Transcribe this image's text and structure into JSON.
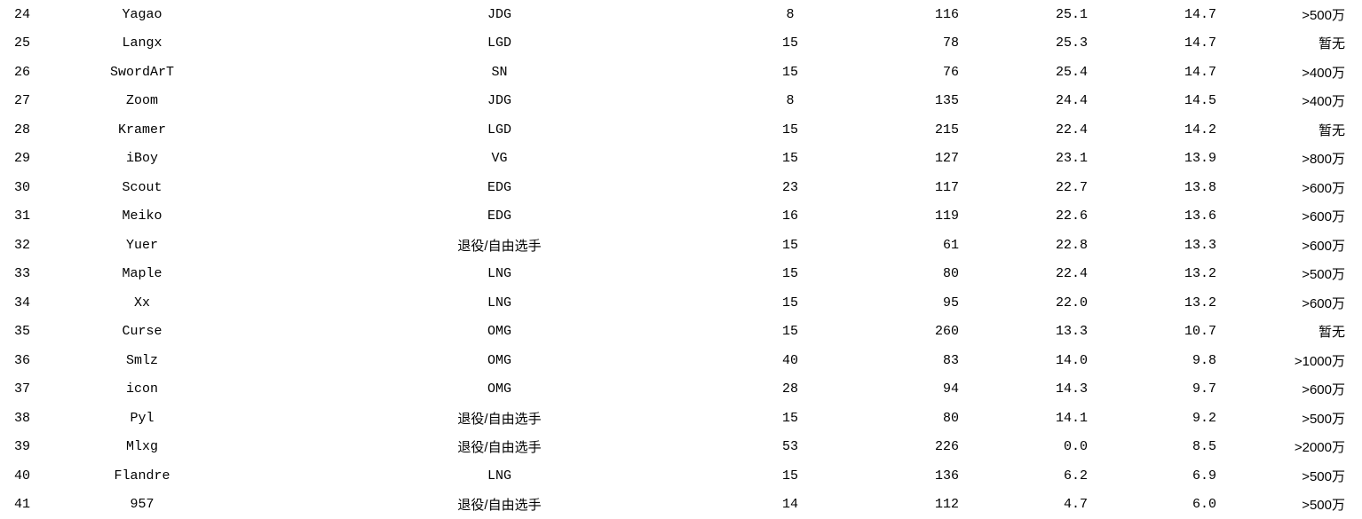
{
  "rows": [
    {
      "rank": "24",
      "player": "Yagao",
      "team": "JDG",
      "c4": "8",
      "c5": "116",
      "c6": "25.1",
      "c7": "14.7",
      "c8": ">500万"
    },
    {
      "rank": "25",
      "player": "Langx",
      "team": "LGD",
      "c4": "15",
      "c5": "78",
      "c6": "25.3",
      "c7": "14.7",
      "c8": "暂无"
    },
    {
      "rank": "26",
      "player": "SwordArT",
      "team": "SN",
      "c4": "15",
      "c5": "76",
      "c6": "25.4",
      "c7": "14.7",
      "c8": ">400万"
    },
    {
      "rank": "27",
      "player": "Zoom",
      "team": "JDG",
      "c4": "8",
      "c5": "135",
      "c6": "24.4",
      "c7": "14.5",
      "c8": ">400万"
    },
    {
      "rank": "28",
      "player": "Kramer",
      "team": "LGD",
      "c4": "15",
      "c5": "215",
      "c6": "22.4",
      "c7": "14.2",
      "c8": "暂无"
    },
    {
      "rank": "29",
      "player": "iBoy",
      "team": "VG",
      "c4": "15",
      "c5": "127",
      "c6": "23.1",
      "c7": "13.9",
      "c8": ">800万"
    },
    {
      "rank": "30",
      "player": "Scout",
      "team": "EDG",
      "c4": "23",
      "c5": "117",
      "c6": "22.7",
      "c7": "13.8",
      "c8": ">600万"
    },
    {
      "rank": "31",
      "player": "Meiko",
      "team": "EDG",
      "c4": "16",
      "c5": "119",
      "c6": "22.6",
      "c7": "13.6",
      "c8": ">600万"
    },
    {
      "rank": "32",
      "player": "Yuer",
      "team": "退役/自由选手",
      "c4": "15",
      "c5": "61",
      "c6": "22.8",
      "c7": "13.3",
      "c8": ">600万"
    },
    {
      "rank": "33",
      "player": "Maple",
      "team": "LNG",
      "c4": "15",
      "c5": "80",
      "c6": "22.4",
      "c7": "13.2",
      "c8": ">500万"
    },
    {
      "rank": "34",
      "player": "Xx",
      "team": "LNG",
      "c4": "15",
      "c5": "95",
      "c6": "22.0",
      "c7": "13.2",
      "c8": ">600万"
    },
    {
      "rank": "35",
      "player": "Curse",
      "team": "OMG",
      "c4": "15",
      "c5": "260",
      "c6": "13.3",
      "c7": "10.7",
      "c8": "暂无"
    },
    {
      "rank": "36",
      "player": "Smlz",
      "team": "OMG",
      "c4": "40",
      "c5": "83",
      "c6": "14.0",
      "c7": "9.8",
      "c8": ">1000万"
    },
    {
      "rank": "37",
      "player": "icon",
      "team": "OMG",
      "c4": "28",
      "c5": "94",
      "c6": "14.3",
      "c7": "9.7",
      "c8": ">600万"
    },
    {
      "rank": "38",
      "player": "Pyl",
      "team": "退役/自由选手",
      "c4": "15",
      "c5": "80",
      "c6": "14.1",
      "c7": "9.2",
      "c8": ">500万"
    },
    {
      "rank": "39",
      "player": "Mlxg",
      "team": "退役/自由选手",
      "c4": "53",
      "c5": "226",
      "c6": "0.0",
      "c7": "8.5",
      "c8": ">2000万"
    },
    {
      "rank": "40",
      "player": "Flandre",
      "team": "LNG",
      "c4": "15",
      "c5": "136",
      "c6": "6.2",
      "c7": "6.9",
      "c8": ">500万"
    },
    {
      "rank": "41",
      "player": "957",
      "team": "退役/自由选手",
      "c4": "14",
      "c5": "112",
      "c6": "4.7",
      "c7": "6.0",
      "c8": ">500万"
    }
  ]
}
